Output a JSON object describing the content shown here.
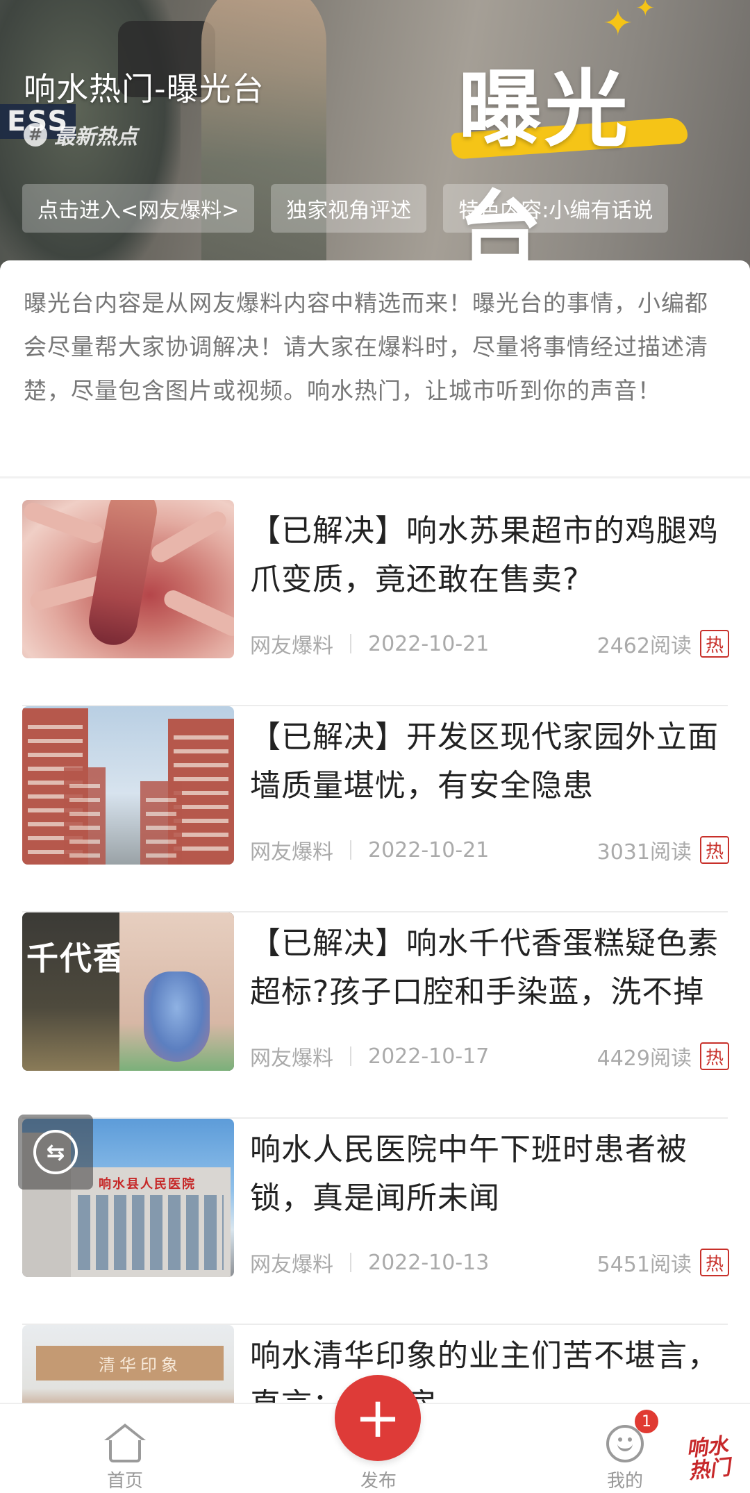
{
  "banner": {
    "title": "响水热门-曝光台",
    "hot_tag": "最新热点",
    "hot_tag_icon": "#",
    "brand_word": "曝光台",
    "press_text": "ESS",
    "pills": [
      "点击进入<网友爆料>",
      "独家视角评述",
      "特色内容:小编有话说"
    ]
  },
  "intro": {
    "text": "曝光台内容是从网友爆料内容中精选而来！曝光台的事情，小编都会尽量帮大家协调解决！请大家在爆料时，尽量将事情经过描述清楚，尽量包含图片或视频。响水热门，让城市听到你的声音！"
  },
  "articles": [
    {
      "title": "【已解决】响水苏果超市的鸡腿鸡爪变质，竟还敢在售卖?",
      "source": "网友爆料",
      "date": "2022-10-21",
      "reads": "2462阅读",
      "badge": "热"
    },
    {
      "title": "【已解决】开发区现代家园外立面墙质量堪忧，有安全隐患",
      "source": "网友爆料",
      "date": "2022-10-21",
      "reads": "3031阅读",
      "badge": "热"
    },
    {
      "title": "【已解决】响水千代香蛋糕疑色素超标?孩子口腔和手染蓝，洗不掉",
      "source": "网友爆料",
      "date": "2022-10-17",
      "reads": "4429阅读",
      "badge": "热",
      "thumb_text": "千代香"
    },
    {
      "title": "响水人民医院中午下班时患者被锁，真是闻所未闻",
      "source": "网友爆料",
      "date": "2022-10-13",
      "reads": "5451阅读",
      "badge": "热",
      "thumb_text": "响水县人民医院"
    },
    {
      "title": "响水清华印象的业主们苦不堪言，直言：...买房",
      "thumb_text": "清华印象"
    }
  ],
  "nav": {
    "home_label": "首页",
    "publish_label": "发布",
    "publish_icon": "+",
    "mine_label": "我的",
    "mine_badge": "1",
    "corner_logo_line1": "响水",
    "corner_logo_line2": "热门"
  },
  "colors": {
    "accent": "#de3b38",
    "hot_badge": "#c8302a",
    "brand_yellow": "#f5c417"
  }
}
